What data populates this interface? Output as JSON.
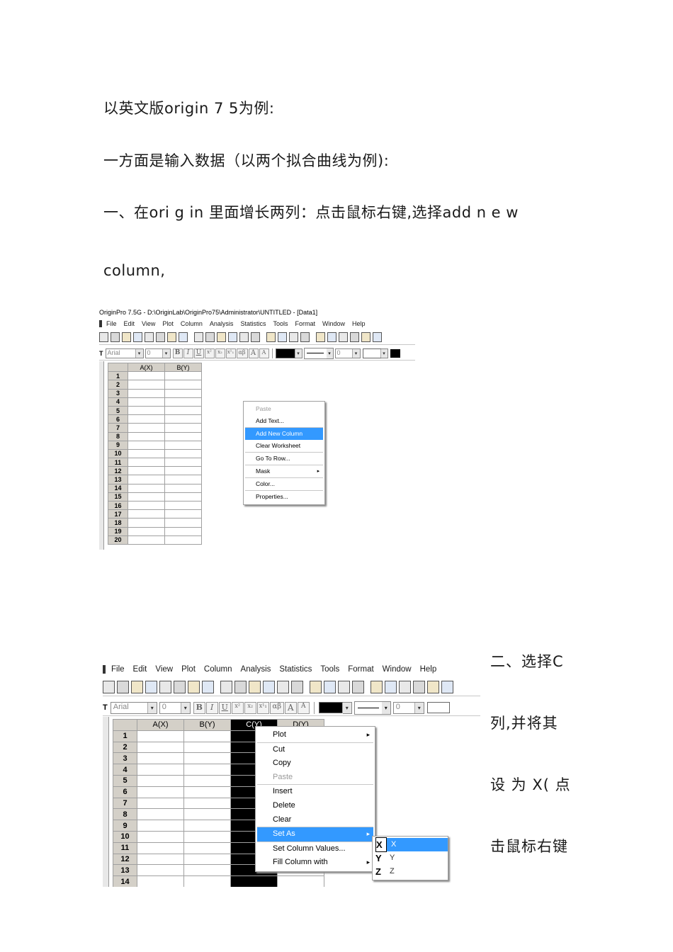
{
  "text": {
    "p1": "以英文版origin 7 5为例:",
    "p2": "一方面是输入数据（以两个拟合曲线为例):",
    "p3": "一、在ori g in 里面增长两列：点击鼠标右键,选择add n e w",
    "p4": "column,",
    "side": [
      "二、选择C",
      "列,并将其",
      "设 为 X( 点",
      "击鼠标右键"
    ]
  },
  "shot1": {
    "title": "OriginPro 7.5G - D:\\OriginLab\\OriginPro75\\Administrator\\UNTITLED - [Data1]",
    "menu": [
      "File",
      "Edit",
      "View",
      "Plot",
      "Column",
      "Analysis",
      "Statistics",
      "Tools",
      "Format",
      "Window",
      "Help"
    ],
    "font_name": "Arial",
    "font_size": "0",
    "line_value": "0",
    "columns": [
      "A(X)",
      "B(Y)"
    ],
    "rows": [
      "1",
      "2",
      "3",
      "4",
      "5",
      "6",
      "7",
      "8",
      "9",
      "10",
      "11",
      "12",
      "13",
      "14",
      "15",
      "16",
      "17",
      "18",
      "19",
      "20"
    ],
    "context_menu": [
      {
        "label": "Paste",
        "disabled": true
      },
      {
        "label": "Add Text..."
      },
      {
        "label": "Add New Column",
        "highlight": true
      },
      {
        "label": "Clear Worksheet"
      },
      {
        "label": "Go To Row..."
      },
      {
        "label": "Mask",
        "submenu": true
      },
      {
        "label": "Color..."
      },
      {
        "label": "Properties..."
      }
    ]
  },
  "shot2": {
    "menu": [
      "File",
      "Edit",
      "View",
      "Plot",
      "Column",
      "Analysis",
      "Statistics",
      "Tools",
      "Format",
      "Window",
      "Help"
    ],
    "font_name": "Arial",
    "font_size": "0",
    "line_value": "0",
    "columns": [
      "A(X)",
      "B(Y)",
      "C(Y)",
      "D(Y)"
    ],
    "rows": [
      "1",
      "2",
      "3",
      "4",
      "5",
      "6",
      "7",
      "8",
      "9",
      "10",
      "11",
      "12",
      "13",
      "14"
    ],
    "context_menu": [
      {
        "label": "Plot",
        "submenu": true
      },
      {
        "label": "Cut"
      },
      {
        "label": "Copy"
      },
      {
        "label": "Paste",
        "disabled": true
      },
      {
        "label": "Insert"
      },
      {
        "label": "Delete"
      },
      {
        "label": "Clear"
      },
      {
        "label": "Set As",
        "highlight": true,
        "submenu": true
      },
      {
        "label": "Set Column Values..."
      },
      {
        "label": "Fill Column with",
        "submenu": true
      }
    ],
    "set_as_menu": [
      {
        "icon": "X",
        "label": "X",
        "highlight": true
      },
      {
        "icon": "Y",
        "label": "Y"
      },
      {
        "icon": "Z",
        "label": "Z"
      }
    ]
  }
}
